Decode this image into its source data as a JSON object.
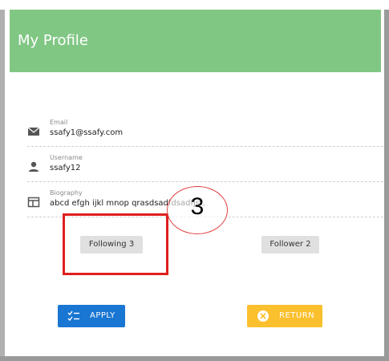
{
  "header": {
    "title": "My Profile"
  },
  "fields": [
    {
      "label": "Email",
      "value": "ssafy1@ssafy.com",
      "icon": "mail-icon"
    },
    {
      "label": "Username",
      "value": "ssafy12",
      "icon": "person-icon"
    },
    {
      "label": "Biography",
      "value": "abcd efgh ijkl mnop qrasdsadfdsadfjst.",
      "icon": "card-icon"
    }
  ],
  "social": {
    "following_label": "Following 3",
    "follower_label": "Follower 2"
  },
  "actions": {
    "apply_label": "APPLY",
    "return_label": "RETURN"
  },
  "annotation": {
    "number": "3"
  },
  "colors": {
    "header": "#81c784",
    "apply": "#1976d2",
    "return": "#fbc02d",
    "highlight": "#e01e1e"
  }
}
